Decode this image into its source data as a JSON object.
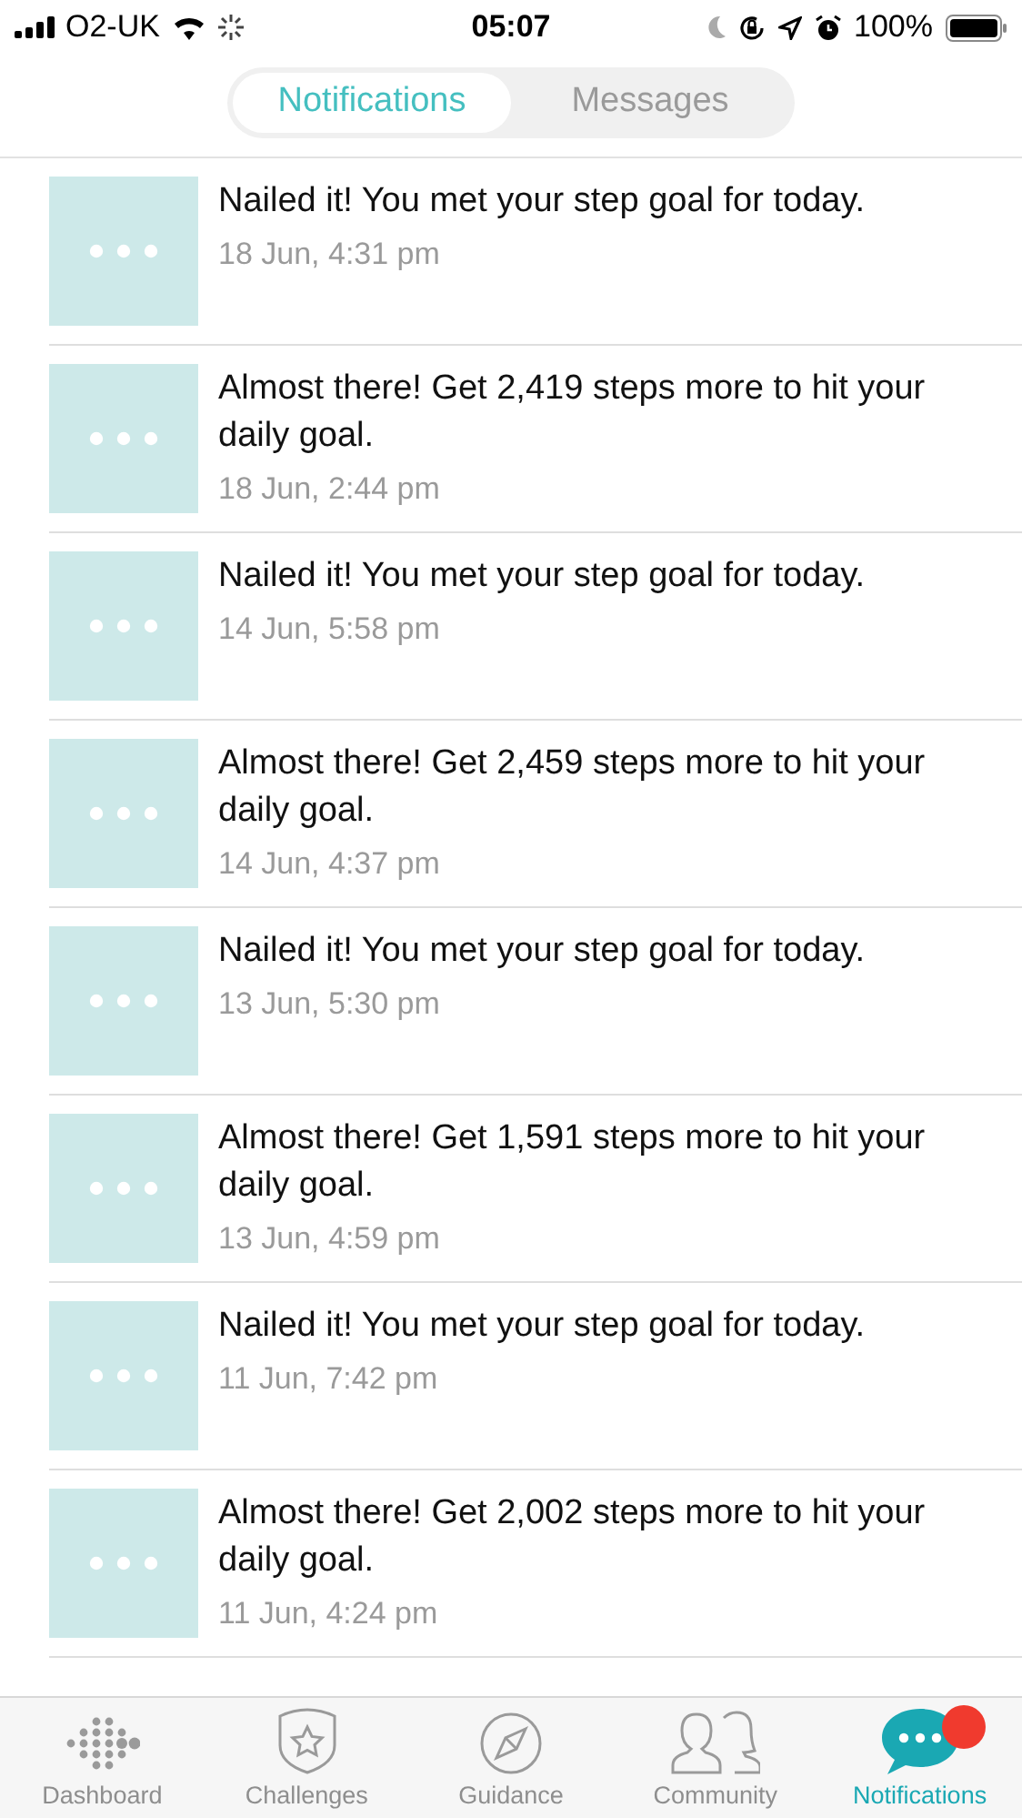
{
  "status_bar": {
    "carrier": "O2-UK",
    "time": "05:07",
    "battery": "100%"
  },
  "tabs": [
    {
      "label": "Notifications",
      "selected": true
    },
    {
      "label": "Messages",
      "selected": false
    }
  ],
  "notifications": [
    {
      "text": "Nailed it! You met your step goal for today.",
      "time": "18 Jun, 4:31 pm"
    },
    {
      "text": "Almost there! Get 2,419 steps more to hit your daily goal.",
      "time": "18 Jun, 2:44 pm"
    },
    {
      "text": "Nailed it! You met your step goal for today.",
      "time": "14 Jun, 5:58 pm"
    },
    {
      "text": "Almost there! Get 2,459 steps more to hit your daily goal.",
      "time": "14 Jun, 4:37 pm"
    },
    {
      "text": "Nailed it! You met your step goal for today.",
      "time": "13 Jun, 5:30 pm"
    },
    {
      "text": "Almost there! Get 1,591 steps more to hit your daily goal.",
      "time": "13 Jun, 4:59 pm"
    },
    {
      "text": "Nailed it! You met your step goal for today.",
      "time": "11 Jun, 7:42 pm"
    },
    {
      "text": "Almost there! Get 2,002 steps more to hit your daily goal.",
      "time": "11 Jun, 4:24 pm"
    }
  ],
  "bottom_nav": [
    {
      "kind": "dashboard",
      "label": "Dashboard",
      "selected": false
    },
    {
      "kind": "challenges",
      "label": "Challenges",
      "selected": false
    },
    {
      "kind": "guidance",
      "label": "Guidance",
      "selected": false
    },
    {
      "kind": "community",
      "label": "Community",
      "selected": false
    },
    {
      "kind": "notifications",
      "label": "Notifications",
      "selected": true,
      "badge": true
    }
  ]
}
